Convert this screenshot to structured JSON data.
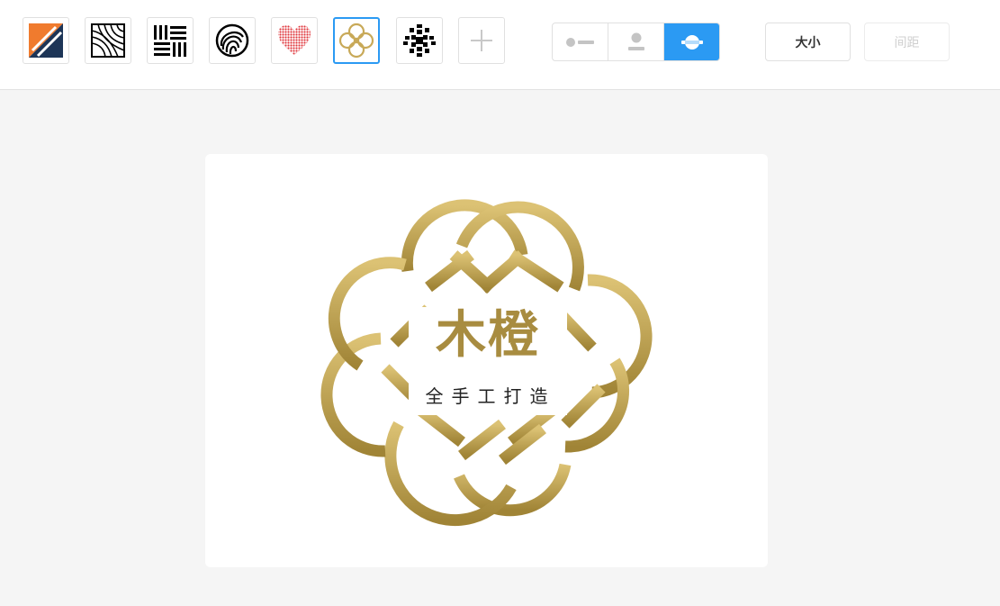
{
  "toolbar": {
    "templates": [
      {
        "name": "orange-navy-stripes-template",
        "selected": false
      },
      {
        "name": "twisted-lines-template",
        "selected": false
      },
      {
        "name": "horizontal-bars-template",
        "selected": false
      },
      {
        "name": "swirl-circle-template",
        "selected": false
      },
      {
        "name": "dotted-heart-template",
        "selected": false
      },
      {
        "name": "gold-knot-template",
        "selected": true
      },
      {
        "name": "pixel-circle-template",
        "selected": false
      }
    ],
    "add_icon": "plus-icon",
    "layout_options": [
      {
        "name": "layout-icon-left",
        "active": false
      },
      {
        "name": "layout-icon-top",
        "active": false
      },
      {
        "name": "layout-icon-behind",
        "active": true
      }
    ],
    "size_label": "大小",
    "spacing_label": "间距"
  },
  "logo": {
    "brand_name": "木橙",
    "slogan": "全手工打造"
  },
  "colors": {
    "accent": "#2b9af3",
    "gold_light": "#dcc274",
    "gold_dark": "#a08436",
    "heart": "#e0393e",
    "orange": "#f07b2e",
    "navy": "#1d3557"
  }
}
